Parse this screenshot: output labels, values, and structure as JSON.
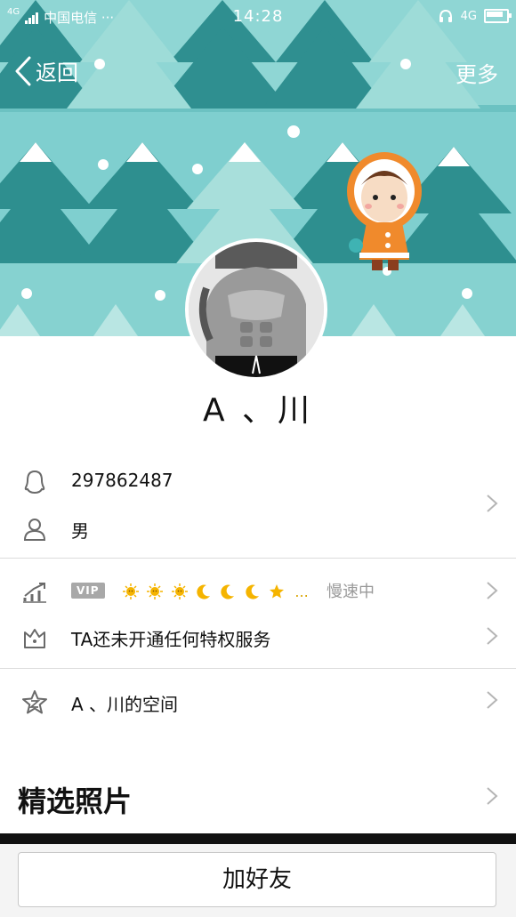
{
  "status_bar": {
    "network_type": "4G",
    "carrier": "中国电信 ···",
    "time": "14:28",
    "data_type": "4G",
    "icons": [
      "signal-icon",
      "headphone-icon",
      "battery-icon"
    ]
  },
  "nav": {
    "back_label": "返回",
    "more_label": "更多"
  },
  "profile": {
    "nickname": "A 、川",
    "qq_number": "297862487",
    "gender": "男"
  },
  "privilege": {
    "vip_badge": "VIP",
    "level_icons": [
      "sun-icon",
      "sun-icon",
      "sun-icon",
      "moon-icon",
      "moon-icon",
      "moon-icon",
      "star-icon"
    ],
    "level_ellipsis": "...",
    "speed_text": "慢速中",
    "services_text": "TA还未开通任何特权服务"
  },
  "space": {
    "label": "A 、川的空间"
  },
  "photos": {
    "section_title": "精选照片"
  },
  "footer": {
    "add_friend_label": "加好友"
  },
  "colors": {
    "banner": "#7fcfcf",
    "tree_dark": "#2e8f8f",
    "tree_mid": "#3ea3a3",
    "divider": "#dcdcdc",
    "chevron": "#b5b5b5",
    "icon_gray": "#6a6a6a"
  }
}
